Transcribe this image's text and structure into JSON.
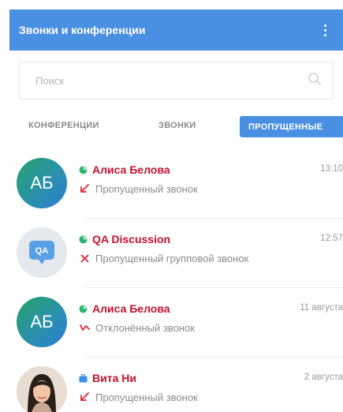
{
  "header": {
    "title": "Звонки и конференции"
  },
  "search": {
    "placeholder": "Поиск"
  },
  "tabs": {
    "conferences": "КОНФЕРЕНЦИИ",
    "calls": "ЗВОНКИ",
    "missed": "ПРОПУЩЕННЫЕ"
  },
  "colors": {
    "accent": "#4a90e2",
    "name": "#c3122e",
    "missed_icon": "#e0243a",
    "status_online": "#2fb26b"
  },
  "items": [
    {
      "avatar_initials": "АБ",
      "name": "Алиса Белова",
      "time": "13:10",
      "description": "Пропущенный звонок",
      "call_icon": "missed-call-arrow-icon"
    },
    {
      "avatar_label": "QA",
      "name": "QA Discussion",
      "time": "12:57",
      "description": "Пропущенный групповой звонок",
      "call_icon": "missed-group-call-x-icon"
    },
    {
      "avatar_initials": "АБ",
      "name": "Алиса Белова",
      "time": "11 августа",
      "description": "Отклонённый звонок",
      "call_icon": "declined-call-icon"
    },
    {
      "name": "Вита Ни",
      "time": "2 августа",
      "description": "Пропущенный звонок",
      "call_icon": "missed-call-arrow-icon"
    }
  ]
}
